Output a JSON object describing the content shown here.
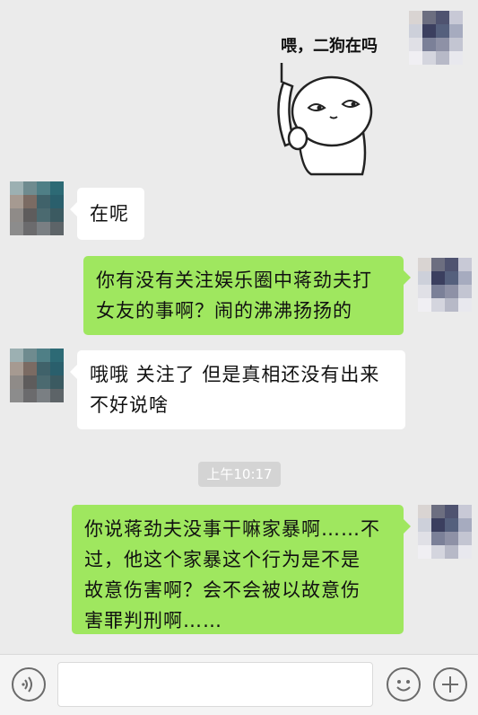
{
  "messages": [
    {
      "id": "m1",
      "side": "out",
      "type": "sticker",
      "text": "喂，二狗在吗"
    },
    {
      "id": "m2",
      "side": "in",
      "type": "text",
      "text": "在呢"
    },
    {
      "id": "m3",
      "side": "out",
      "type": "text",
      "lines": [
        "你有没有关注娱乐圈中蒋劲夫打",
        "女友的事啊？闹的沸沸扬扬的"
      ]
    },
    {
      "id": "m4",
      "side": "in",
      "type": "text",
      "lines": [
        "哦哦 关注了 但是真相还没有出来",
        "不好说啥"
      ]
    },
    {
      "id": "m5",
      "side": "out",
      "type": "text",
      "lines": [
        "你说蒋劲夫没事干嘛家暴啊……不",
        "过，他这个家暴这个行为是不是",
        "故意伤害啊？会不会被以故意伤",
        "害罪判刑啊……"
      ]
    }
  ],
  "timestamp": "上午10:17",
  "input": {
    "value": ""
  },
  "icons": {
    "voice": "voice-icon",
    "emoji": "emoji-icon",
    "add": "plus-icon"
  },
  "colors": {
    "background": "#ebebeb",
    "outgoing_bubble": "#9fe75f",
    "incoming_bubble": "#ffffff"
  }
}
